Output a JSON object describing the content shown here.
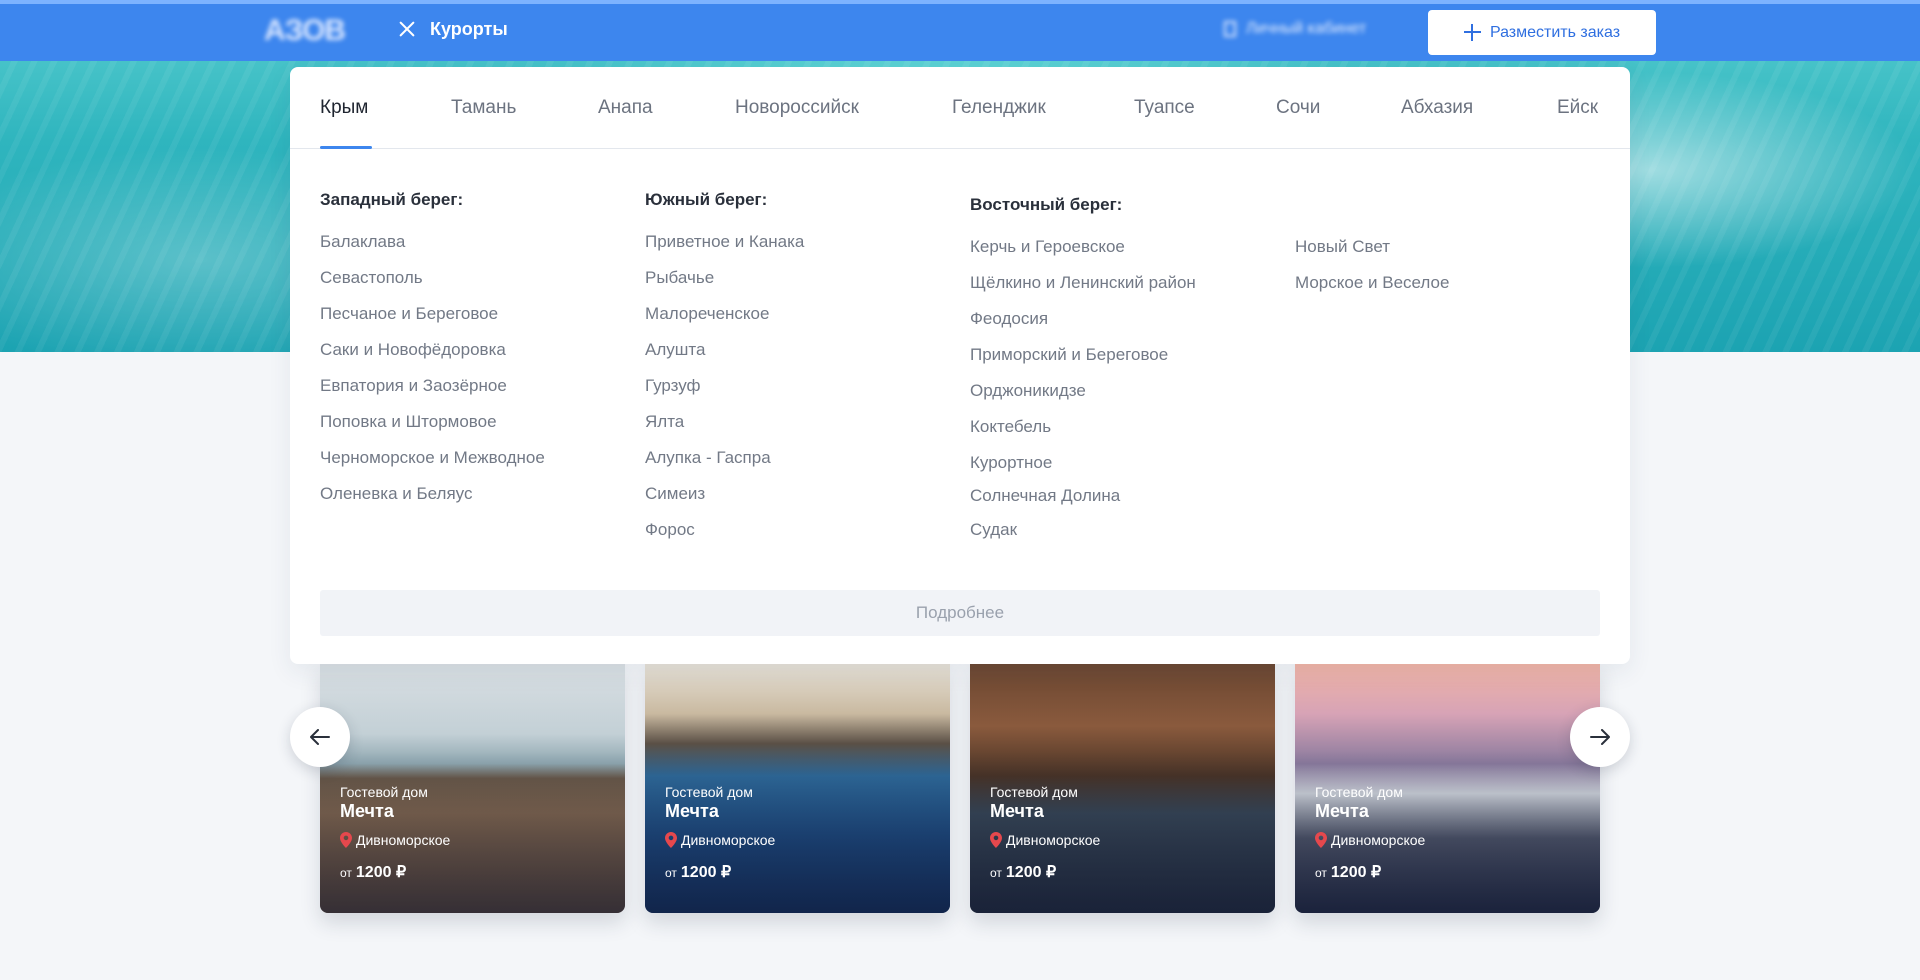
{
  "header": {
    "logo_text": "АЗОВ",
    "menu_label": "Курорты",
    "cabinet_label": "Личный кабинет",
    "order_button": "Разместить заказ"
  },
  "tabs": [
    "Крым",
    "Тамань",
    "Анапа",
    "Новороссийск",
    "Геленджик",
    "Туапсе",
    "Сочи",
    "Абхазия",
    "Ейск"
  ],
  "active_tab": "Крым",
  "columns": [
    {
      "title": "Западный берег:",
      "items": [
        "Балаклава",
        "Севастополь",
        "Песчаное и Береговое",
        "Саки и Новофёдоровка",
        "Евпатория и Заозёрное",
        "Поповка и Штормовое",
        "Черноморское и Межводное",
        "Оленевка и Беляус"
      ]
    },
    {
      "title": "Южный берег:",
      "items": [
        "Приветное и Канака",
        "Рыбачье",
        "Малореченское",
        "Алушта",
        "Гурзуф",
        "Ялта",
        "Алупка - Гаспра",
        "Симеиз",
        "Форос"
      ]
    },
    {
      "title": "Восточный берег:",
      "items": [
        "Керчь и Героевское",
        "Щёлкино и Ленинский район",
        "Феодосия",
        "Приморский и Береговое",
        "Орджоникидзе",
        "Коктебель",
        "Курортное",
        "Солнечная Долина",
        "Судак"
      ]
    },
    {
      "title": "",
      "items": [
        "Новый Свет",
        "Морское и Веселое"
      ]
    }
  ],
  "more_button": "Подробнее",
  "cards": [
    {
      "type": "Гостевой дом",
      "name": "Мечта",
      "location": "Дивноморское",
      "price_prefix": "от",
      "price": "1200 ₽"
    },
    {
      "type": "Гостевой дом",
      "name": "Мечта",
      "location": "Дивноморское",
      "price_prefix": "от",
      "price": "1200 ₽"
    },
    {
      "type": "Гостевой дом",
      "name": "Мечта",
      "location": "Дивноморское",
      "price_prefix": "от",
      "price": "1200 ₽"
    },
    {
      "type": "Гостевой дом",
      "name": "Мечта",
      "location": "Дивноморское",
      "price_prefix": "от",
      "price": "1200 ₽"
    }
  ],
  "colors": {
    "brand": "#3d86ee",
    "accent": "#2f6fe0",
    "pin": "#e5484d"
  }
}
